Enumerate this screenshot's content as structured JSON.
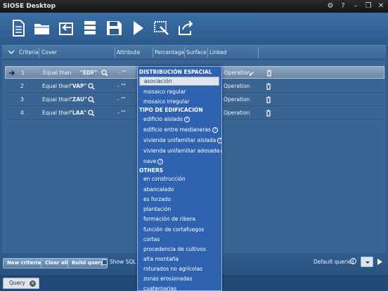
{
  "app": {
    "title": "SIOSE Desktop"
  },
  "titlebar": {
    "gear": "⚙",
    "help": "?",
    "minimize": "–",
    "restore": "❐",
    "close": "✕"
  },
  "columns": [
    "Criteria",
    "Cover",
    "Attribute",
    "Percentage",
    "Surface",
    "Linked"
  ],
  "rows": [
    {
      "num": "1",
      "op": "Equal than",
      "val": "\"EDF\"",
      "attr": "- \"\"",
      "linked": "Operation",
      "selected": true
    },
    {
      "num": "2",
      "op": "Equal than",
      "val": "\"VAP\"",
      "attr": "- \"\"",
      "linked": "Operation",
      "selected": false
    },
    {
      "num": "3",
      "op": "Equal than",
      "val": "\"ZAU\"",
      "attr": "- \"\"",
      "linked": "Operation",
      "selected": false
    },
    {
      "num": "4",
      "op": "Equal than",
      "val": "\"LAA\"",
      "attr": "- \"\"",
      "linked": "Operation",
      "selected": false
    }
  ],
  "bottom": {
    "new_criteria": "New criteria",
    "clear_all": "Clear all",
    "build_query": "Build query",
    "show_sql": "Show SQL q",
    "default_queries": "Default queries"
  },
  "tab": {
    "label": "Query"
  },
  "dropdown": {
    "groups": [
      {
        "title": "DISTRIBUCIÓN ESPACIAL",
        "items": [
          {
            "label": "asociación",
            "help": false,
            "active": true
          },
          {
            "label": "mosaico regular",
            "help": false
          },
          {
            "label": "mosaico irregular",
            "help": false
          }
        ]
      },
      {
        "title": "TIPO DE EDIFICACIÓN",
        "items": [
          {
            "label": "edificio aislado",
            "help": true
          },
          {
            "label": "edificio entre medianeras",
            "help": true
          },
          {
            "label": "vivienda unifamiliar aislada",
            "help": true
          },
          {
            "label": "vivienda unifamiliar adosada",
            "help": true
          },
          {
            "label": "nave",
            "help": true
          }
        ]
      },
      {
        "title": "OTHERS",
        "items": [
          {
            "label": "en construcción",
            "help": false
          },
          {
            "label": "abancalado",
            "help": false
          },
          {
            "label": "es forzado",
            "help": false
          },
          {
            "label": "plantación",
            "help": false
          },
          {
            "label": "formación de ribera",
            "help": false
          },
          {
            "label": "función de cortafuegos",
            "help": false
          },
          {
            "label": "cortas",
            "help": false
          },
          {
            "label": "procedencia de cultivos",
            "help": false
          },
          {
            "label": "alta montaña",
            "help": false
          },
          {
            "label": "roturados no agrícolas",
            "help": false
          },
          {
            "label": "zonas erosionadas",
            "help": false
          },
          {
            "label": "cuaternarias",
            "help": false
          }
        ]
      }
    ]
  },
  "colors": {
    "accent": "#2f63b0",
    "background": "#2f5c8e",
    "selected_row": "#7f98b3"
  },
  "icons": [
    "new-document-icon",
    "open-folder-icon",
    "back-icon",
    "server-icon",
    "save-icon",
    "run-icon",
    "edit-select-icon",
    "export-icon"
  ]
}
